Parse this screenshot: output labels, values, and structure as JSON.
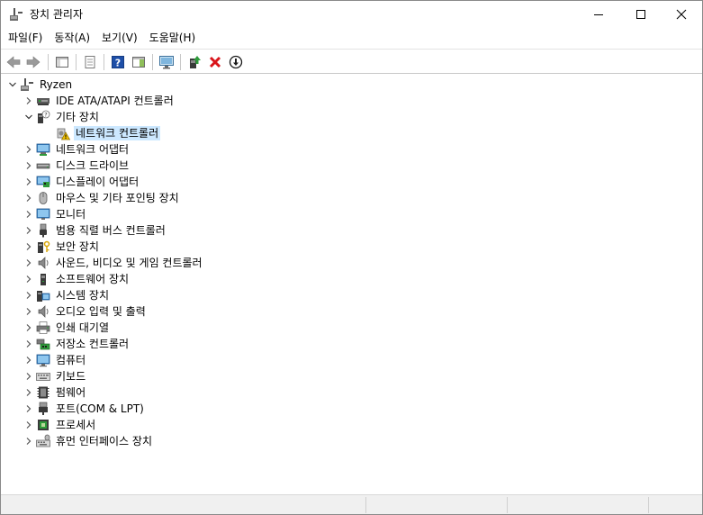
{
  "window": {
    "title": "장치 관리자"
  },
  "menu": [
    {
      "label": "파일(F)"
    },
    {
      "label": "동작(A)"
    },
    {
      "label": "보기(V)"
    },
    {
      "label": "도움말(H)"
    }
  ],
  "tree": {
    "root": "Ryzen",
    "items": [
      {
        "label": "IDE ATA/ATAPI 컨트롤러",
        "icon": "ide-controller-icon"
      },
      {
        "label": "기타 장치",
        "icon": "unknown-device-icon",
        "expanded": true
      },
      {
        "label": "네트워크 컨트롤러",
        "icon": "warning-device-icon",
        "child": true,
        "selected": true
      },
      {
        "label": "네트워크 어댑터",
        "icon": "network-adapter-icon"
      },
      {
        "label": "디스크 드라이브",
        "icon": "disk-drive-icon"
      },
      {
        "label": "디스플레이 어댑터",
        "icon": "display-adapter-icon"
      },
      {
        "label": "마우스 및 기타 포인팅 장치",
        "icon": "mouse-icon"
      },
      {
        "label": "모니터",
        "icon": "monitor-icon"
      },
      {
        "label": "범용 직렬 버스 컨트롤러",
        "icon": "usb-icon"
      },
      {
        "label": "보안 장치",
        "icon": "security-key-icon"
      },
      {
        "label": "사운드, 비디오 및 게임 컨트롤러",
        "icon": "speaker-icon"
      },
      {
        "label": "소프트웨어 장치",
        "icon": "software-device-icon"
      },
      {
        "label": "시스템 장치",
        "icon": "system-device-icon"
      },
      {
        "label": "오디오 입력 및 출력",
        "icon": "audio-icon"
      },
      {
        "label": "인쇄 대기열",
        "icon": "printer-icon"
      },
      {
        "label": "저장소 컨트롤러",
        "icon": "storage-controller-icon"
      },
      {
        "label": "컴퓨터",
        "icon": "computer-icon"
      },
      {
        "label": "키보드",
        "icon": "keyboard-icon"
      },
      {
        "label": "펌웨어",
        "icon": "firmware-icon"
      },
      {
        "label": "포트(COM & LPT)",
        "icon": "port-icon"
      },
      {
        "label": "프로세서",
        "icon": "processor-icon"
      },
      {
        "label": "휴먼 인터페이스 장치",
        "icon": "hid-icon"
      }
    ]
  },
  "colors": {
    "selection": "#cce8ff",
    "accent": "#1e6fd9",
    "delete": "#d9141a",
    "warning": "#f2c200"
  }
}
